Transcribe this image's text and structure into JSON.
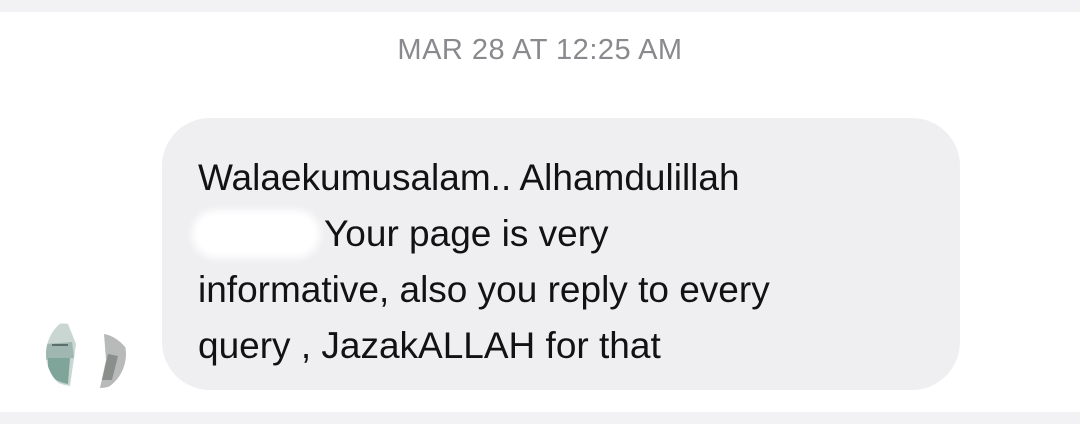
{
  "conversation": {
    "timestamp": "MAR 28 AT 12:25 AM",
    "message": {
      "line1": "Walaekumusalam.. Alhamdulillah",
      "line2": "Your page is very",
      "line3": "informative, also you reply to every",
      "line4": "query , JazakALLAH for that"
    },
    "sender_avatar": {
      "icon": "avatar-photo-icon"
    }
  }
}
